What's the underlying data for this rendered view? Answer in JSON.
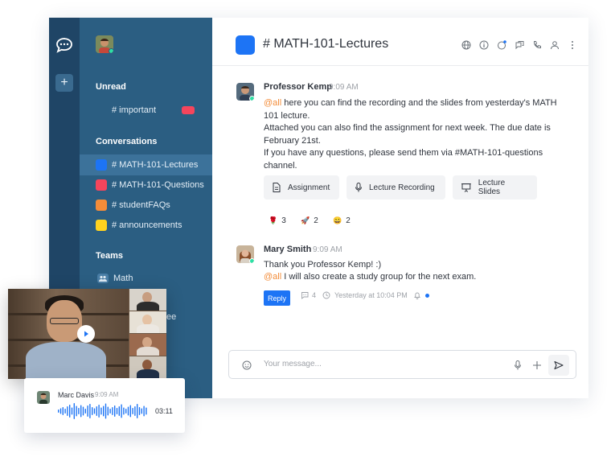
{
  "colors": {
    "rail": "#1f4566",
    "sidebar": "#2b5e82",
    "sidebar_active": "#3c729a",
    "accent": "#1d74f5",
    "mention": "#f38c39",
    "online": "#2de0a5",
    "red": "#f5455c"
  },
  "sidebar": {
    "unread_title": "Unread",
    "unread_items": [
      {
        "label": "# important",
        "color": "#f5455c"
      }
    ],
    "conversations_title": "Conversations",
    "conversations": [
      {
        "label": "# MATH-101-Lectures",
        "color": "#1d74f5",
        "active": true
      },
      {
        "label": "# MATH-101-Questions",
        "color": "#f5455c",
        "active": false
      },
      {
        "label": "# studentFAQs",
        "color": "#f38c39",
        "active": false
      },
      {
        "label": "# announcements",
        "color": "#ffd21f",
        "active": false
      }
    ],
    "teams_title": "Teams",
    "teams": [
      {
        "label": "Math"
      },
      {
        "label": "ee"
      }
    ]
  },
  "header": {
    "title": "# MATH-101-Lectures",
    "icons": [
      "globe-icon",
      "info-icon",
      "threads-icon",
      "discussion-icon",
      "phone-icon",
      "members-icon",
      "kebab-menu-icon"
    ]
  },
  "messages": [
    {
      "author": "Professor Kemp",
      "time": "9:09 AM",
      "mention": "@all",
      "lines": [
        " here you can find the recording and the slides from yesterday's MATH",
        "101 lecture.",
        "Attached you can also find the assignment for next week. The due date is",
        "February 21st.",
        "If you have any questions, please send them via #MATH-101-questions",
        "channel."
      ],
      "attachments": [
        {
          "label": "Assignment",
          "icon": "document-icon"
        },
        {
          "label": "Lecture Recording",
          "icon": "microphone-icon"
        },
        {
          "label": "Lecture Slides",
          "icon": "presentation-icon"
        }
      ],
      "reactions": [
        {
          "emoji": "🌹",
          "count": "3"
        },
        {
          "emoji": "🚀",
          "count": "2"
        },
        {
          "emoji": "😄",
          "count": "2"
        }
      ]
    },
    {
      "author": "Mary Smith",
      "time": "9:09 AM",
      "line1": "Thank you Professor Kemp! :)",
      "mention": "@all",
      "line2": " I will also create a study group for the next exam.",
      "reply_label": "Reply",
      "reply_count": "4",
      "last_reply": "Yesterday at 10:04 PM"
    }
  ],
  "composer": {
    "placeholder": "Your message..."
  },
  "audio": {
    "author": "Marc Davis",
    "time": "9:09 AM",
    "duration": "03:11"
  }
}
